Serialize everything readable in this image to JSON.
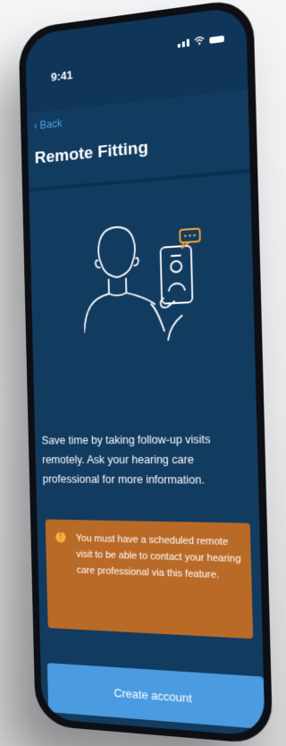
{
  "status_bar": {
    "time": "9:41"
  },
  "nav": {
    "back_label": "Back"
  },
  "page": {
    "title": "Remote Fitting"
  },
  "intro": {
    "text": "Save time by taking follow-up visits remotely. Ask your hearing care professional for more information."
  },
  "notice": {
    "icon": "info-icon",
    "text": "You must have a scheduled remote visit to be able to contact your hearing care professional via this feature."
  },
  "actions": {
    "create_account_label": "Create account"
  },
  "colors": {
    "screen_background": "#123b60",
    "link": "#4aa3ea",
    "notice_background": "#b96a27",
    "notice_icon": "#f4b23c",
    "button_background": "#4a9be0",
    "illustration_accent": "#f2a23a"
  }
}
